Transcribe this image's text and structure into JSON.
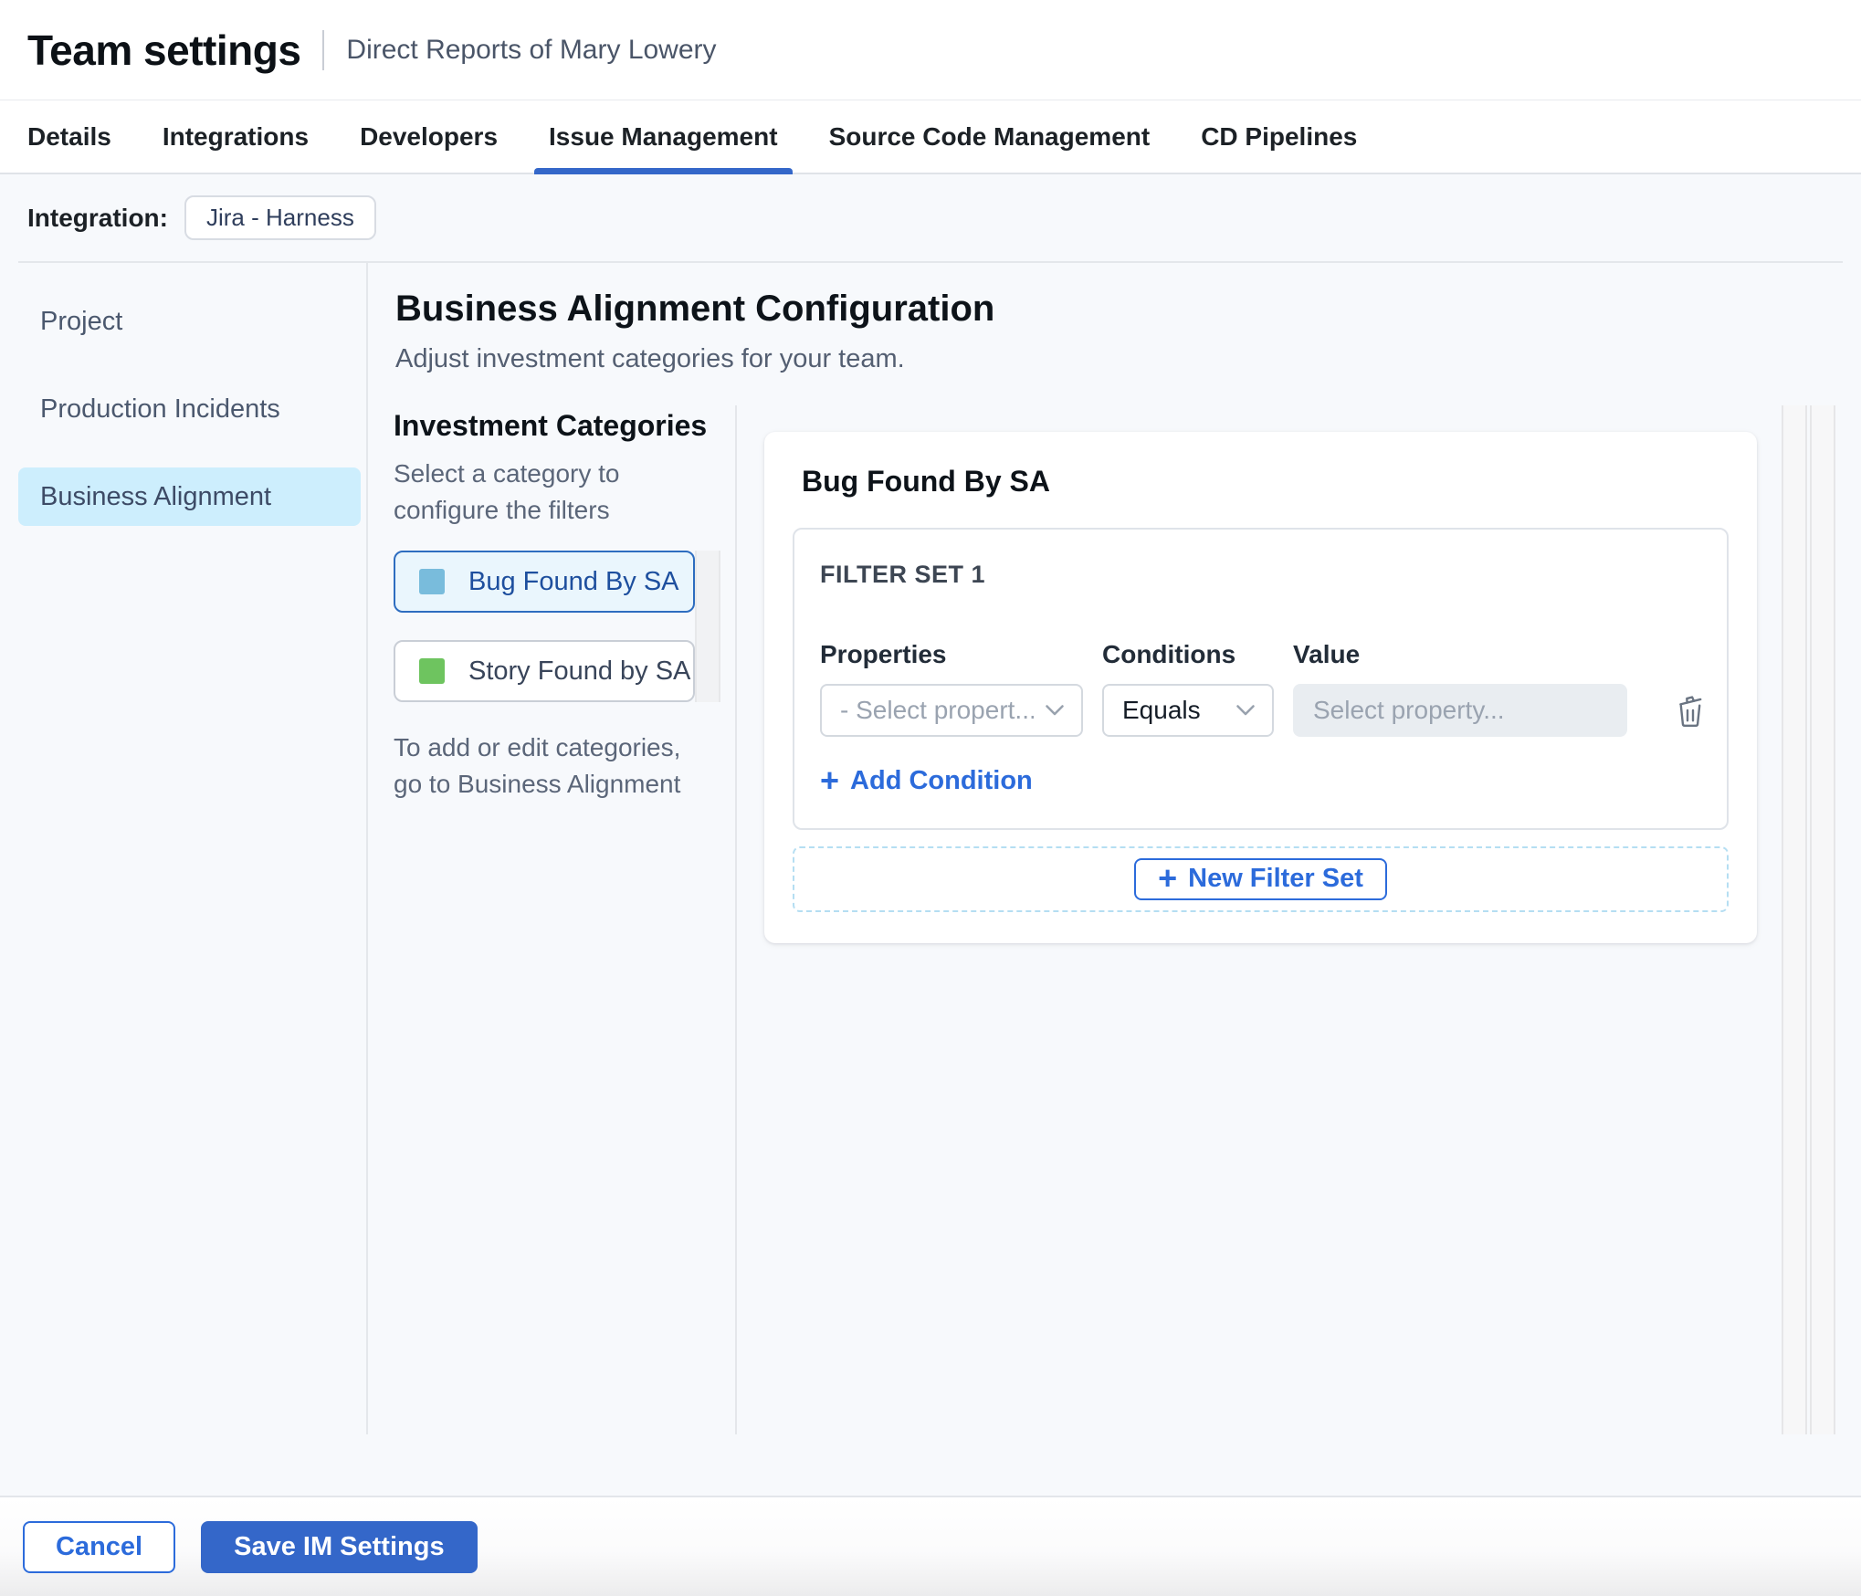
{
  "header": {
    "title": "Team settings",
    "subtitle": "Direct Reports of Mary Lowery"
  },
  "tabs": {
    "items": [
      {
        "label": "Details"
      },
      {
        "label": "Integrations"
      },
      {
        "label": "Developers"
      },
      {
        "label": "Issue Management"
      },
      {
        "label": "Source Code Management"
      },
      {
        "label": "CD Pipelines"
      }
    ],
    "active": "Issue Management"
  },
  "integration": {
    "label": "Integration:",
    "value": "Jira - Harness"
  },
  "sidebar": {
    "items": [
      {
        "label": "Project"
      },
      {
        "label": "Production Incidents"
      },
      {
        "label": "Business Alignment"
      }
    ],
    "active": "Business Alignment"
  },
  "config": {
    "title": "Business Alignment Configuration",
    "subtitle": "Adjust investment categories for your team."
  },
  "categories": {
    "heading": "Investment Categories",
    "help": "Select a category to configure the filters",
    "items": [
      {
        "label": "Bug Found By SA",
        "swatch_color": "#79bcdc",
        "selected": true
      },
      {
        "label": "Story Found by SA",
        "swatch_color": "#6ec45f",
        "selected": false
      }
    ],
    "note": "To add or edit categories, go to Business Alignment"
  },
  "filter_panel": {
    "title": "Bug Found By SA",
    "filter_set": {
      "title": "FILTER SET 1",
      "columns": {
        "properties": "Properties",
        "conditions": "Conditions",
        "value": "Value"
      },
      "condition_row": {
        "property_placeholder": "- Select propert...",
        "condition_value": "Equals",
        "value_placeholder": "Select property..."
      },
      "add_condition_label": "Add Condition"
    },
    "new_filter_set_label": "New Filter Set"
  },
  "footer": {
    "cancel_label": "Cancel",
    "save_label": "Save IM Settings"
  },
  "colors": {
    "accent_blue": "#3467c9",
    "link_blue": "#2c6bdb",
    "nav_selected_bg": "#cdeefd",
    "category_selected_bg": "#eaf6fd",
    "category_selected_border": "#2e6dc0",
    "swatch_blue": "#79bcdc",
    "swatch_green": "#6ec45f",
    "value_input_bg": "#e9edf1"
  }
}
